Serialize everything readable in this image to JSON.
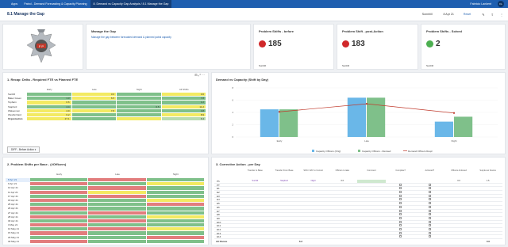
{
  "topbar": {
    "apps": "Apps",
    "tabs": [
      "Patrol - Demand Forecasting & Capacity Planning",
      "8. Demand vs Capacity Gap Analysis / 8.1 Manage the Gap"
    ],
    "user": "Fabricio Lankent",
    "avatar": "FL"
  },
  "toolbar": {
    "title": "8.1 Manage the Gap",
    "filter_value": "Sonnhill",
    "date_value": "8 Apr 21",
    "reset": "Reset"
  },
  "manage": {
    "title": "Manage the Gap",
    "desc": "Manage the gap between forecasted demand & planned patrol capacity"
  },
  "kpis": [
    {
      "title": "Problem Shifts - before",
      "value": "185",
      "footer": "Sunhill",
      "color": "#d0282a"
    },
    {
      "title": "Problem Shift - post-Action",
      "value": "183",
      "footer": "Sunhill",
      "color": "#d0282a"
    },
    {
      "title": "Problem Shifts - Solved",
      "value": "2",
      "footer": "Sunhill",
      "color": "#4caf50"
    }
  ],
  "recap": {
    "title": "1. Recap: Delta - Required FTE vs Planned FTE",
    "cols": [
      "Early",
      "Late",
      "Night",
      "All Shifts"
    ],
    "rows": [
      {
        "label": "Sunhill",
        "values": [
          "",
          "3.0",
          "",
          "3.0"
        ]
      },
      {
        "label": "Baker Green",
        "values": [
          "1.3",
          "6.5",
          "",
          "7.8"
        ]
      },
      {
        "label": "Topbarn",
        "values": [
          "0.6",
          "",
          "",
          "1.2"
        ]
      },
      {
        "label": "Stapford",
        "values": [
          "4.4",
          "",
          "6.5",
          "11.2"
        ]
      },
      {
        "label": "Wakeomen",
        "values": [
          "4.0",
          "7.8",
          "",
          "4.8"
        ]
      },
      {
        "label": "Westbrchard",
        "values": [
          "6.2",
          "",
          "",
          "8.9"
        ]
      },
      {
        "label": "Organisation",
        "values": [
          "27.1",
          "",
          "",
          "6.4"
        ]
      }
    ],
    "button": "DIFF - Before Action"
  },
  "dvc": {
    "title": "Demand vs Capacity (Shift by Day)",
    "legend": [
      "Capacity Officers (Orig)",
      "Capacity Officers - Revised",
      "Demand Officers Reqd"
    ]
  },
  "chart_data": {
    "type": "bar",
    "categories": [
      "Early",
      "Late",
      "Night"
    ],
    "series": [
      {
        "name": "Capacity Officers (Orig)",
        "values": [
          4.5,
          6.4,
          2.5
        ]
      },
      {
        "name": "Capacity Officers - Revised",
        "values": [
          4.5,
          6.4,
          3.3
        ]
      },
      {
        "name": "Demand Officers Reqd",
        "values": [
          4.1,
          5.4,
          3.9
        ]
      }
    ],
    "ylim": [
      0,
      8
    ],
    "colors": [
      "#6ab7e8",
      "#7fc08a",
      "#c0392b"
    ]
  },
  "prob": {
    "title": "2. Problem Shifts per Base - (#Officers)",
    "cols": [
      "Early",
      "Late",
      "Night"
    ],
    "rows": [
      "8 Apr 21",
      "9 Apr 21",
      "10 Apr 21",
      "11 Apr 21",
      "17 Apr 21",
      "18 Apr 21",
      "25 Apr 21",
      "26 Apr 21",
      "27 Apr 21",
      "28 Apr 21",
      "30 Apr 21",
      "3 May 21",
      "10 May 21",
      "15 May 21",
      "29 May 21",
      "30 May 21"
    ]
  },
  "corr": {
    "title": "3. Corrective Action - per Day",
    "cols": [
      "Transfer to Base",
      "Transfer From Base",
      "Shift / DAY to Correct",
      "Officers to take",
      "Comment",
      "Complete?",
      "Actioned?",
      "Officers Actioned",
      "Surplus at Source"
    ],
    "rows": [
      "Ph",
      "PT",
      "E1",
      "E2",
      "E3",
      "E4",
      "E5",
      "E6",
      "E7",
      "E8",
      "E9",
      "E10",
      "E11",
      "E12",
      "E13",
      "E14"
    ],
    "row1": [
      "Sunhill",
      "Stapford",
      "Night",
      "6.0",
      "",
      "",
      "",
      "0.0",
      "1.5"
    ],
    "footer": "All Shows",
    "footer_vals": [
      "6.2",
      "0.0"
    ]
  }
}
